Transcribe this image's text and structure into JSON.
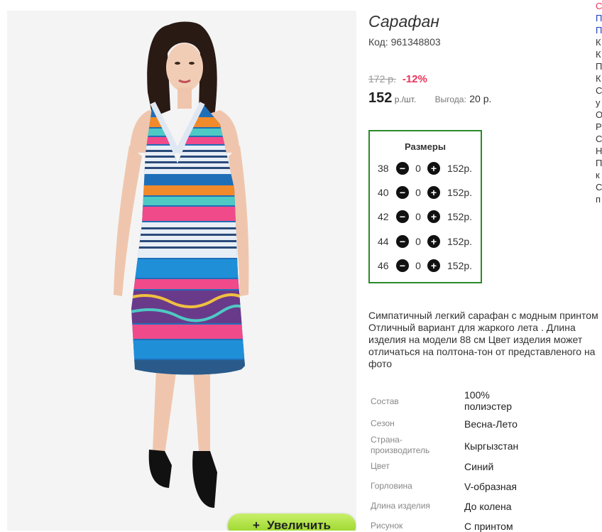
{
  "product": {
    "title": "Сарафан",
    "code": "Код: 961348803",
    "old_price": "172 р.",
    "discount": "-12%",
    "price": "152",
    "unit": " р./шт.",
    "savings_label": "Выгода:",
    "savings_value": "20 р."
  },
  "zoom_button": {
    "icon": "plus-icon",
    "symbol": "+",
    "label": "Увеличить"
  },
  "sizes": {
    "title": "Размеры",
    "rows": [
      {
        "size": "38",
        "qty": "0",
        "price": "152р."
      },
      {
        "size": "40",
        "qty": "0",
        "price": "152р."
      },
      {
        "size": "42",
        "qty": "0",
        "price": "152р."
      },
      {
        "size": "44",
        "qty": "0",
        "price": "152р."
      },
      {
        "size": "46",
        "qty": "0",
        "price": "152р."
      }
    ]
  },
  "description": {
    "lines": [
      "Симпатичный легкий сарафан с модным принтом",
      "Отличный вариант для жаркого лета . Длина",
      "изделия на модели 88 см Цвет изделия может",
      "отличаться на полтона-тон от представленого на",
      "фото"
    ]
  },
  "attributes": [
    {
      "key": "Состав",
      "value": "100% полиэстер"
    },
    {
      "key": "Сезон",
      "value": "Весна-Лето"
    },
    {
      "key": "Страна-производитель",
      "value": "Кыргызстан"
    },
    {
      "key": "Цвет",
      "value": "Синий"
    },
    {
      "key": "Горловина",
      "value": "V-образная"
    },
    {
      "key": "Длина изделия",
      "value": "До колена"
    },
    {
      "key": "Рисунок",
      "value": "С принтом"
    }
  ],
  "right_column_cut": [
    "С",
    "П",
    "П",
    "К",
    "К",
    "П",
    "К",
    "С",
    "у",
    "О",
    "Р",
    "С",
    "Н",
    "П",
    "к",
    "С",
    "п"
  ],
  "colors": {
    "accent_red": "#e8345a",
    "link_blue": "#1a3fc0",
    "size_border": "#2a8a2a",
    "zoom_green": "#a6e03a"
  }
}
